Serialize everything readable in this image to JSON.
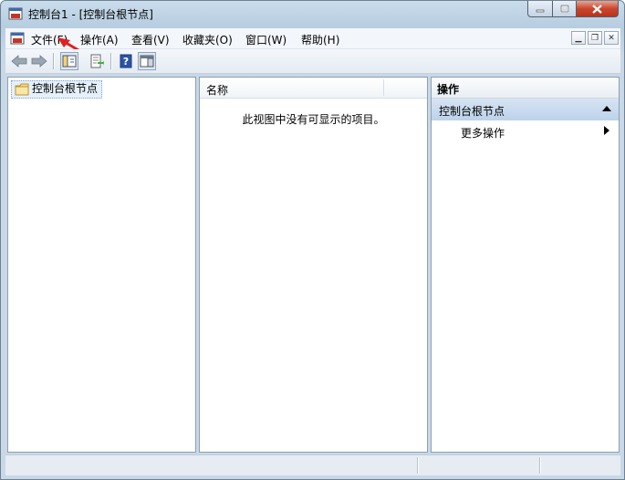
{
  "window": {
    "title": "控制台1 - [控制台根节点]"
  },
  "menubar": {
    "items": [
      {
        "label": "文件(F)"
      },
      {
        "label": "操作(A)"
      },
      {
        "label": "查看(V)"
      },
      {
        "label": "收藏夹(O)"
      },
      {
        "label": "窗口(W)"
      },
      {
        "label": "帮助(H)"
      }
    ]
  },
  "toolbar": {
    "buttons": [
      "back-icon",
      "forward-icon",
      "show-hide-tree-icon",
      "export-list-icon",
      "help-icon",
      "show-hide-action-pane-icon"
    ]
  },
  "tree": {
    "root_label": "控制台根节点"
  },
  "list": {
    "column_header": "名称",
    "empty_message": "此视图中没有可显示的项目。"
  },
  "actions": {
    "header": "操作",
    "section_title": "控制台根节点",
    "more_actions": "更多操作"
  },
  "colors": {
    "title_bar": "#c9dcec",
    "close_button": "#c9462c",
    "action_section": "#bcd2ea",
    "selection": "#e5f0fb"
  }
}
